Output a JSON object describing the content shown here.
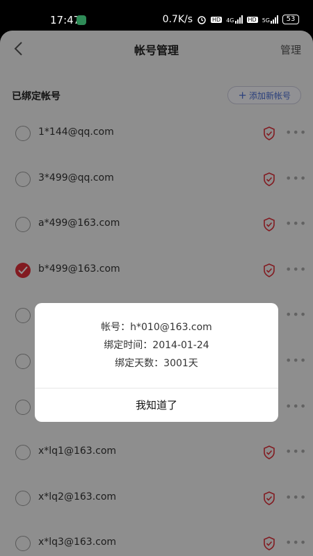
{
  "status_bar": {
    "time": "17:47",
    "network_speed": "0.7K/s",
    "alarm_icon": "alarm-icon",
    "hd1": "HD",
    "net1": "4G",
    "hd2": "HD",
    "net2": "5G",
    "battery": "53"
  },
  "header": {
    "title": "帐号管理",
    "manage_label": "管理",
    "back_icon": "back-arrow-icon"
  },
  "section": {
    "title": "已绑定帐号",
    "add_button_label": "添加新帐号"
  },
  "accounts": [
    {
      "email": "1*144@qq.com",
      "checked": false
    },
    {
      "email": "3*499@qq.com",
      "checked": false
    },
    {
      "email": "a*499@163.com",
      "checked": false
    },
    {
      "email": "b*499@163.com",
      "checked": true
    },
    {
      "email": "",
      "checked": false
    },
    {
      "email": "",
      "checked": false
    },
    {
      "email": "",
      "checked": false
    },
    {
      "email": "x*lq1@163.com",
      "checked": false
    },
    {
      "email": "x*lq2@163.com",
      "checked": false
    },
    {
      "email": "x*lq3@163.com",
      "checked": false
    }
  ],
  "dialog": {
    "account_line": "帐号：h*010@163.com",
    "bind_time_line": "绑定时间：2014-01-24",
    "bind_days_line": "绑定天数：3001天",
    "confirm_label": "我知道了"
  },
  "colors": {
    "accent_red": "#e0303a",
    "link_blue": "#4a6fd6"
  }
}
